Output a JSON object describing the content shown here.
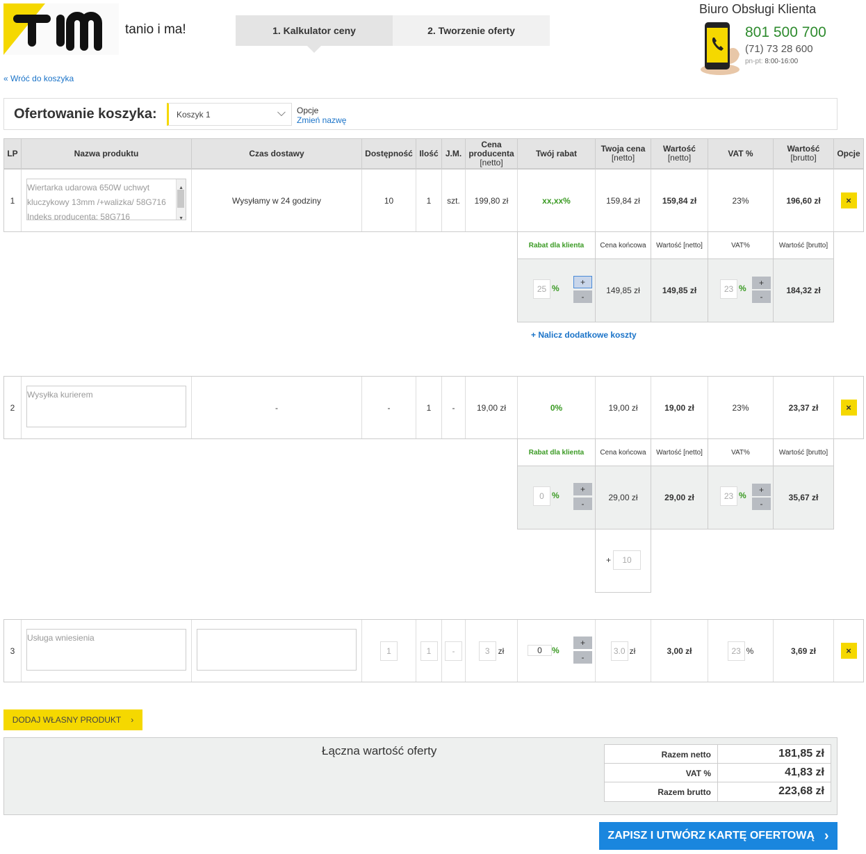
{
  "header": {
    "tagline": "tanio i ma!",
    "steps": [
      {
        "label": "1. Kalkulator ceny"
      },
      {
        "label": "2. Tworzenie oferty"
      }
    ],
    "service": {
      "title": "Biuro Obsługi Klienta",
      "hotline": "801 500 700",
      "phone": "(71) 73 28 600",
      "hours_label": "pn-pt:",
      "hours": "8:00-16:00"
    }
  },
  "back_link": "Wróć do koszyka",
  "offer_bar": {
    "label": "Ofertowanie koszyka:",
    "basket": "Koszyk 1",
    "options_label": "Opcje",
    "rename_link": "Zmień nazwę"
  },
  "columns": {
    "lp": "LP",
    "name": "Nazwa produktu",
    "delivery": "Czas dostawy",
    "availability": "Dostępność",
    "qty": "Ilość",
    "unit": "J.M.",
    "producer_price_1": "Cena",
    "producer_price_2": "producenta",
    "producer_price_3": "[netto]",
    "discount": "Twój rabat",
    "your_price_1": "Twoja cena",
    "your_price_2": "[netto]",
    "value_net_1": "Wartość",
    "value_net_2": "[netto]",
    "vat": "VAT %",
    "value_gross_1": "Wartość",
    "value_gross_2": "[brutto]",
    "options": "Opcje"
  },
  "rows": [
    {
      "lp": "1",
      "name_lines": [
        "Wiertarka udarowa 650W uchwyt",
        "kluczykowy 13mm /+walizka/ 58G716",
        "Indeks producenta: 58G716"
      ],
      "delivery": "Wysyłamy w 24 godziny",
      "availability": "10",
      "qty": "1",
      "unit": "szt.",
      "producer_price": "199,80 zł",
      "discount": "xx,xx%",
      "your_price": "159,84 zł",
      "value_net": "159,84 zł",
      "vat": "23%",
      "value_gross": "196,60 zł",
      "delete": "×"
    },
    {
      "lp": "2",
      "name": "Wysyłka kurierem",
      "delivery": "-",
      "availability": "-",
      "qty": "1",
      "unit": "-",
      "producer_price": "19,00 zł",
      "discount": "0%",
      "your_price": "19,00 zł",
      "value_net": "19,00 zł",
      "vat": "23%",
      "value_gross": "23,37 zł",
      "delete": "×"
    },
    {
      "lp": "3",
      "name_placeholder": "Usługa wniesienia",
      "availability": "1",
      "qty": "1",
      "unit": "-",
      "producer_price": "3",
      "currency": "zł",
      "discount": "0",
      "pct": "%",
      "your_price": "3.0",
      "value_net": "3,00 zł",
      "vat": "23",
      "value_gross": "3,69 zł",
      "delete": "×"
    }
  ],
  "sub_headers": {
    "client_discount": "Rabat dla klienta",
    "final_price": "Cena końcowa",
    "value_net": "Wartość [netto]",
    "vat": "VAT%",
    "value_gross": "Wartość [brutto]"
  },
  "sub_rows": [
    {
      "discount": "25",
      "pct": "%",
      "final_price": "149,85 zł",
      "value_net": "149,85 zł",
      "vat": "23",
      "value_gross": "184,32 zł"
    },
    {
      "discount": "0",
      "pct": "%",
      "final_price": "29,00 zł",
      "value_net": "29,00 zł",
      "vat": "23",
      "value_gross": "35,67 zł",
      "extra_sign": "+",
      "extra_value": "10"
    }
  ],
  "plus": "+",
  "minus": "-",
  "extra_costs_link": "+ Nalicz dodatkowe koszty",
  "add_product_button": "DODAJ WŁASNY PRODUKT",
  "summary": {
    "title": "Łączna wartość oferty",
    "rows": [
      {
        "label": "Razem netto",
        "value": "181,85 zł"
      },
      {
        "label": "VAT %",
        "value": "41,83 zł"
      },
      {
        "label": "Razem brutto",
        "value": "223,68 zł"
      }
    ]
  },
  "save_button": "ZAPISZ I UTWÓRZ KARTĘ OFERTOWĄ",
  "colors": {
    "brand_yellow": "#f5d800",
    "link_blue": "#1a73c8",
    "accent_green": "#3a9a23",
    "save_blue": "#1a86de"
  }
}
